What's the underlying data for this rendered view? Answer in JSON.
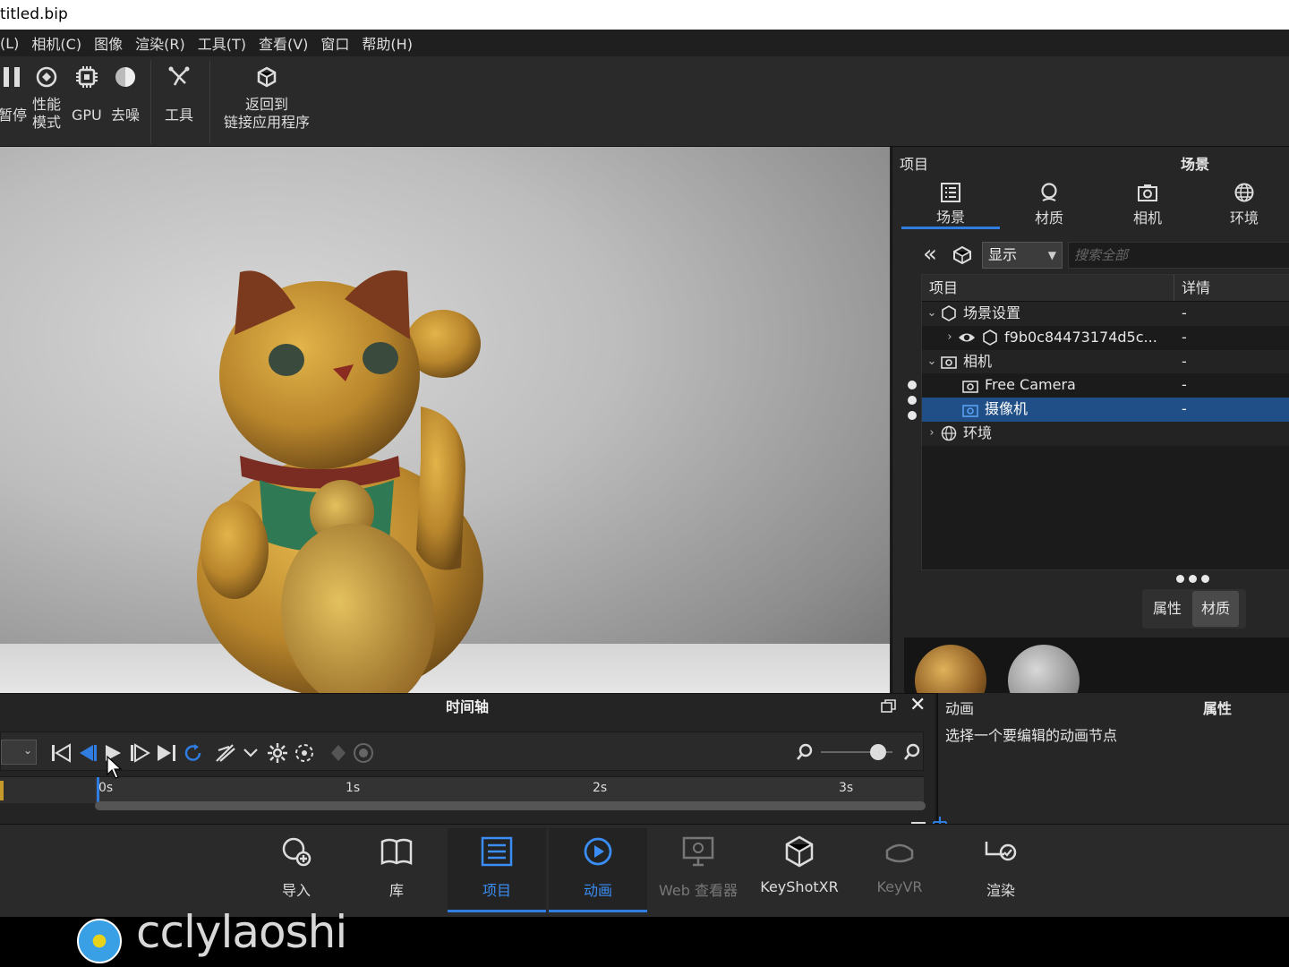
{
  "window": {
    "title": "titled.bip"
  },
  "menu": [
    "(L)",
    "相机(C)",
    "图像",
    "渲染(R)",
    "工具(T)",
    "查看(V)",
    "窗口",
    "帮助(H)"
  ],
  "toolbar": {
    "pause": "暂停",
    "perf_l1": "性能",
    "perf_l2": "模式",
    "gpu": "GPU",
    "denoise": "去噪",
    "tools": "工具",
    "back_l1": "返回到",
    "back_l2": "链接应用程序"
  },
  "right_panel": {
    "header_left": "项目",
    "header_right": "场景",
    "tabs": [
      "场景",
      "材质",
      "相机",
      "环境"
    ],
    "display_select": "显示",
    "search_placeholder": "搜索全部",
    "tree_cols": [
      "项目",
      "详情"
    ],
    "tree_rows": [
      {
        "label": "场景设置",
        "detail": "-"
      },
      {
        "label": "f9b0c84473174d5c...",
        "detail": "-"
      },
      {
        "label": "相机",
        "detail": "-"
      },
      {
        "label": "Free Camera",
        "detail": "-"
      },
      {
        "label": "摄像机",
        "detail": "-"
      },
      {
        "label": "环境",
        "detail": ""
      }
    ],
    "sub_tabs": [
      "属性",
      "材质"
    ]
  },
  "timeline": {
    "title": "时间轴",
    "ruler": [
      "0s",
      "1s",
      "2s",
      "3s"
    ]
  },
  "anim_panel": {
    "title_left": "动画",
    "title_right": "属性",
    "hint": "选择一个要编辑的动画节点"
  },
  "bottom_bar": [
    "导入",
    "库",
    "项目",
    "动画",
    "Web 查看器",
    "KeyShotXR",
    "KeyVR",
    "渲染"
  ],
  "watermark": "cclylaoshi",
  "colors": {
    "accent": "#2f7de1",
    "selection": "#1f4f86"
  }
}
